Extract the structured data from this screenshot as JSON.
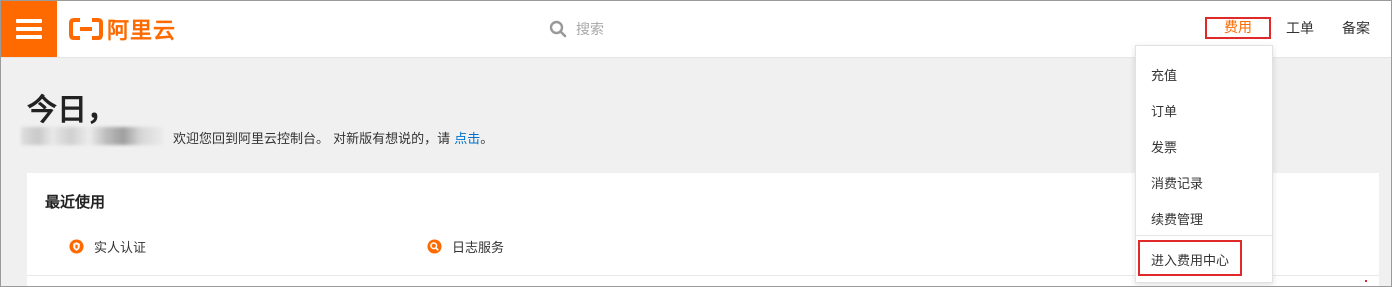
{
  "header": {
    "logo_text": "阿里云",
    "search_placeholder": "搜索",
    "nav": {
      "fee": "费用",
      "ticket": "工单",
      "record": "备案"
    }
  },
  "greeting": {
    "title": "今日，",
    "welcome_prefix": "欢迎您回到阿里云控制台。 对新版有想说的，请 ",
    "welcome_link": "点击",
    "welcome_suffix": "。"
  },
  "recent": {
    "title": "最近使用",
    "items": [
      {
        "label": "实人认证",
        "icon": "shield-icon"
      },
      {
        "label": "日志服务",
        "icon": "log-search-icon"
      }
    ]
  },
  "fee_menu": {
    "items": [
      "充值",
      "订单",
      "发票",
      "消费记录",
      "续费管理"
    ],
    "enter_label": "进入费用中心"
  },
  "colors": {
    "brand": "#ff6a00",
    "highlight": "#e02a2a",
    "link": "#0070cc"
  }
}
